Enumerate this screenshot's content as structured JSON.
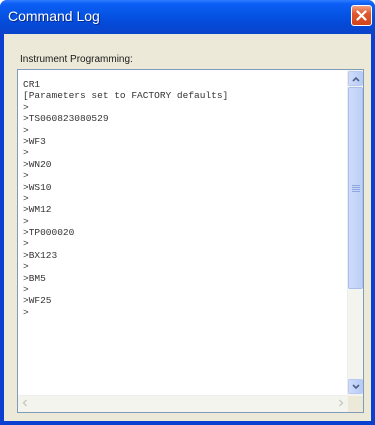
{
  "window": {
    "title": "Command Log",
    "close_icon": "close-icon"
  },
  "group": {
    "label": "Instrument Programming:"
  },
  "log": {
    "lines": [
      "CR1",
      "[Parameters set to FACTORY defaults]",
      ">",
      ">TS060823080529",
      ">",
      ">WF3",
      ">",
      ">WN20",
      ">",
      ">WS10",
      ">",
      ">WM12",
      ">",
      ">TP000020",
      ">",
      ">BX123",
      ">",
      ">BM5",
      ">",
      ">WF25",
      ">"
    ]
  },
  "colors": {
    "titlebar": "#0553e3",
    "close_button": "#d2441a",
    "dialog_background": "#ece9d8",
    "textbox_border": "#7f9db9"
  }
}
